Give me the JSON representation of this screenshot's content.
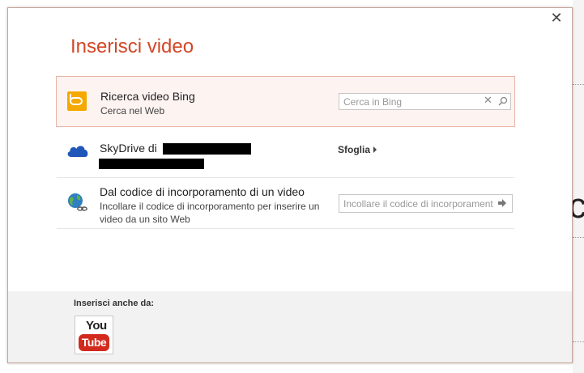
{
  "dialog": {
    "title": "Inserisci video",
    "close_glyph": "✕"
  },
  "bing": {
    "icon": "bing-icon",
    "title": "Ricerca video Bing",
    "subtitle": "Cerca nel Web",
    "search_placeholder": "Cerca in Bing",
    "clear_glyph": "✕",
    "accent_color": "#f5a800"
  },
  "skydrive": {
    "icon": "cloud-icon",
    "title": "SkyDrive di",
    "browse_label": "Sfoglia"
  },
  "embed": {
    "icon": "globe-link-icon",
    "title": "Dal codice di incorporamento di un video",
    "subtitle": "Incollare il codice di incorporamento per inserire un video da un sito Web",
    "input_placeholder": "Incollare il codice di incorporament"
  },
  "footer": {
    "label": "Inserisci anche da:",
    "youtube_top": "You",
    "youtube_bottom": "Tube"
  },
  "colors": {
    "title": "#d24726",
    "selected_row_bg": "#fdf3f1",
    "selected_row_border": "#e9b4a5"
  }
}
